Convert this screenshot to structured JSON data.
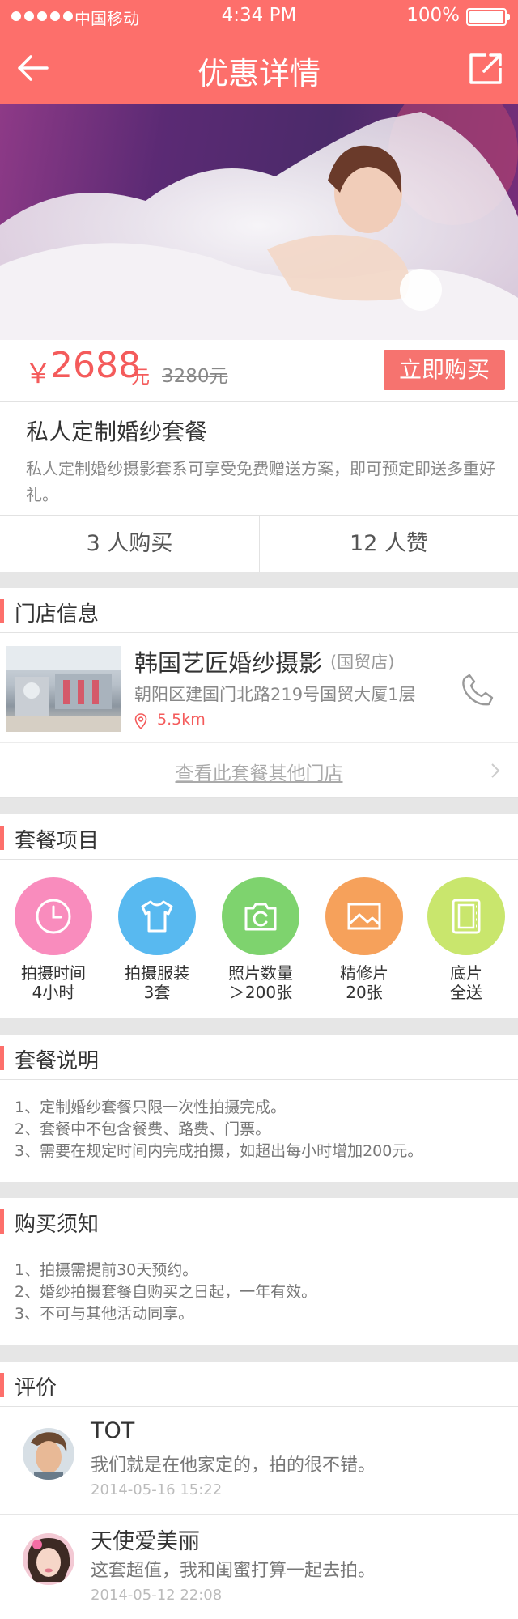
{
  "status_bar": {
    "carrier": "中国移动",
    "time": "4:34 PM",
    "battery": "100%"
  },
  "nav": {
    "title": "优惠详情",
    "back_icon": "arrow-left-icon",
    "share_icon": "share-icon"
  },
  "price": {
    "currency": "￥",
    "value": "2688",
    "unit": "元",
    "original": "3280元",
    "buy_label": "立即购买"
  },
  "package": {
    "title": "私人定制婚纱套餐",
    "description": "私人定制婚纱摄影套系可享受免费赠送方案，即可预定即送多重好礼。"
  },
  "stats": {
    "buyers": "3 人购买",
    "likes": "12 人赞"
  },
  "store_section": {
    "title": "门店信息",
    "name": "韩国艺匠婚纱摄影",
    "branch": "(国贸店)",
    "address": "朝阳区建国门北路219号国贸大厦1层",
    "distance": "5.5km",
    "more_link": "查看此套餐其他门店"
  },
  "items_section": {
    "title": "套餐项目",
    "items": [
      {
        "line1": "拍摄时间",
        "line2": "4小时",
        "color": "#f98cbd",
        "icon": "clock-icon"
      },
      {
        "line1": "拍摄服装",
        "line2": "3套",
        "color": "#58b9f0",
        "icon": "tshirt-icon"
      },
      {
        "line1": "照片数量",
        "line2": "＞200张",
        "color": "#7ed36e",
        "icon": "camera-icon"
      },
      {
        "line1": "精修片",
        "line2": "20张",
        "color": "#f6a15b",
        "icon": "picture-icon"
      },
      {
        "line1": "底片",
        "line2": "全送",
        "color": "#c9e66d",
        "icon": "film-icon"
      }
    ]
  },
  "notes_section": {
    "title": "套餐说明",
    "lines": [
      "1、定制婚纱套餐只限一次性拍摄完成。",
      "2、套餐中不包含餐费、路费、门票。",
      "3、需要在规定时间内完成拍摄，如超出每小时增加200元。"
    ]
  },
  "purchase_section": {
    "title": "购买须知",
    "lines": [
      "1、拍摄需提前30天预约。",
      "2、婚纱拍摄套餐自购买之日起，一年有效。",
      "3、不可与其他活动同享。"
    ]
  },
  "reviews_section": {
    "title": "评价",
    "reviews": [
      {
        "name": "TOT",
        "text": "我们就是在他家定的，拍的很不错。",
        "time": "2014-05-16   15:22"
      },
      {
        "name": "天使爱美丽",
        "text": "这套超值，我和闺蜜打算一起去拍。",
        "time": "2014-05-12   22:08"
      }
    ]
  },
  "colors": {
    "accent": "#fd6f6b",
    "price": "#f45b5b"
  }
}
